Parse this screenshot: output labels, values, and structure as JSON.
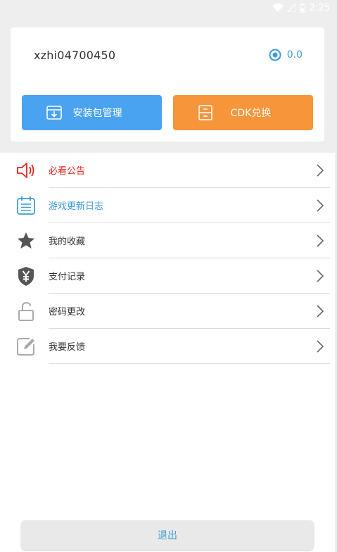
{
  "status_bar": {
    "time": "2:25"
  },
  "account": {
    "id": "xzhi04700450",
    "balance": "0.0"
  },
  "actions": {
    "install_label": "安装包管理",
    "cdk_label": "CDK兑换"
  },
  "menu": {
    "items": [
      {
        "label": "必看公告",
        "color": "#e2231a",
        "icon": "speaker-icon"
      },
      {
        "label": "游戏更新日志",
        "color": "#3b9bd8",
        "icon": "calendar-icon"
      },
      {
        "label": "我的收藏",
        "color": "#333333",
        "icon": "star-icon"
      },
      {
        "label": "支付记录",
        "color": "#333333",
        "icon": "yen-shield-icon"
      },
      {
        "label": "密码更改",
        "color": "#333333",
        "icon": "unlock-icon"
      },
      {
        "label": "我要反馈",
        "color": "#333333",
        "icon": "edit-icon"
      }
    ]
  },
  "logout_label": "退出",
  "colors": {
    "accent_blue": "#4aa3f0",
    "accent_orange": "#f6953a",
    "alert_red": "#e2231a"
  }
}
